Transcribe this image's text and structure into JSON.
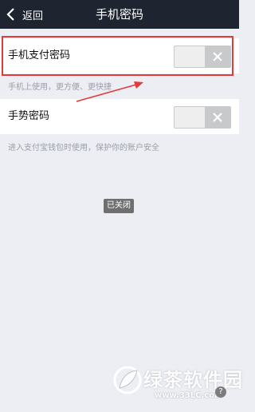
{
  "header": {
    "back_label": "返回",
    "title": "手机密码"
  },
  "settings": [
    {
      "label": "手机支付密码",
      "enabled": false,
      "hint": "手机上使用，更方便、更快捷"
    },
    {
      "label": "手势密码",
      "enabled": false,
      "hint": "进入支付宝钱包时使用，保护你的账户安全"
    }
  ],
  "status_badge": "已关闭",
  "watermark": {
    "brand": "绿茶软件园",
    "url": "www.33LC.com",
    "badge": "?"
  },
  "colors": {
    "titlebar": "#1e2430",
    "background": "#eceef4",
    "highlight": "#e23a3a"
  }
}
